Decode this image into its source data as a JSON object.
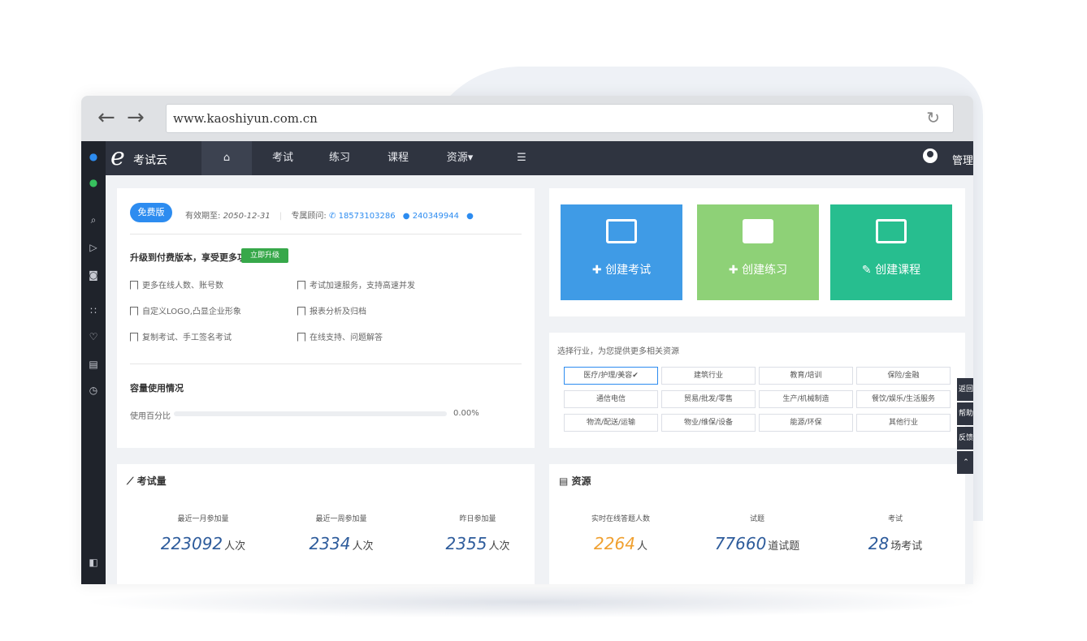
{
  "browser": {
    "url": "www.kaoshiyun.com.cn"
  },
  "nav": {
    "logo_text": "考试云",
    "items": [
      "考试",
      "练习",
      "课程",
      "资源▾"
    ],
    "admin": "管理"
  },
  "info": {
    "badge": "免费版",
    "expiry_label": "有效期至:",
    "expiry_value": "2050-12-31",
    "advisor_label": "专属顾问:",
    "phone": "18573103286",
    "qq": "240349944",
    "upgrade_title": "升级到付费版本，享受更多功能",
    "upgrade_button": "立即升级",
    "features": [
      "更多在线人数、账号数",
      "考试加速服务，支持高速并发",
      "自定义LOGO,凸显企业形象",
      "报表分析及归档",
      "复制考试、手工签名考试",
      "在线支持、问题解答"
    ],
    "capacity_title": "容量使用情况",
    "usage_label": "使用百分比",
    "usage_value": "0.00%",
    "usage_fraction": 0
  },
  "tiles": [
    {
      "label": "✚ 创建考试",
      "color": "#3f9be6"
    },
    {
      "label": "✚ 创建练习",
      "color": "#8ed177"
    },
    {
      "label": "✎ 创建课程",
      "color": "#27be8f"
    }
  ],
  "industry": {
    "prompt": "选择行业，为您提供更多相关资源",
    "options": [
      "医疗/护理/美容✔",
      "建筑行业",
      "教育/培训",
      "保险/金融",
      "通信电信",
      "贸易/批发/零售",
      "生产/机械制造",
      "餐饮/娱乐/生活服务",
      "物流/配送/运输",
      "物业/维保/设备",
      "能源/环保",
      "其他行业"
    ]
  },
  "float_menu": [
    "返回",
    "帮助",
    "反馈",
    "⌃"
  ],
  "exam_stats": {
    "title": "考试量",
    "items": [
      {
        "label": "最近一月参加量",
        "value": "223092",
        "unit": "人次"
      },
      {
        "label": "最近一周参加量",
        "value": "2334",
        "unit": "人次"
      },
      {
        "label": "昨日参加量",
        "value": "2355",
        "unit": "人次"
      }
    ]
  },
  "resource_stats": {
    "title": "资源",
    "items": [
      {
        "label": "实时在线答题人数",
        "value": "2264",
        "unit": "人"
      },
      {
        "label": "试题",
        "value": "77660",
        "unit": "道试题"
      },
      {
        "label": "考试",
        "value": "28",
        "unit": "场考试"
      }
    ]
  }
}
